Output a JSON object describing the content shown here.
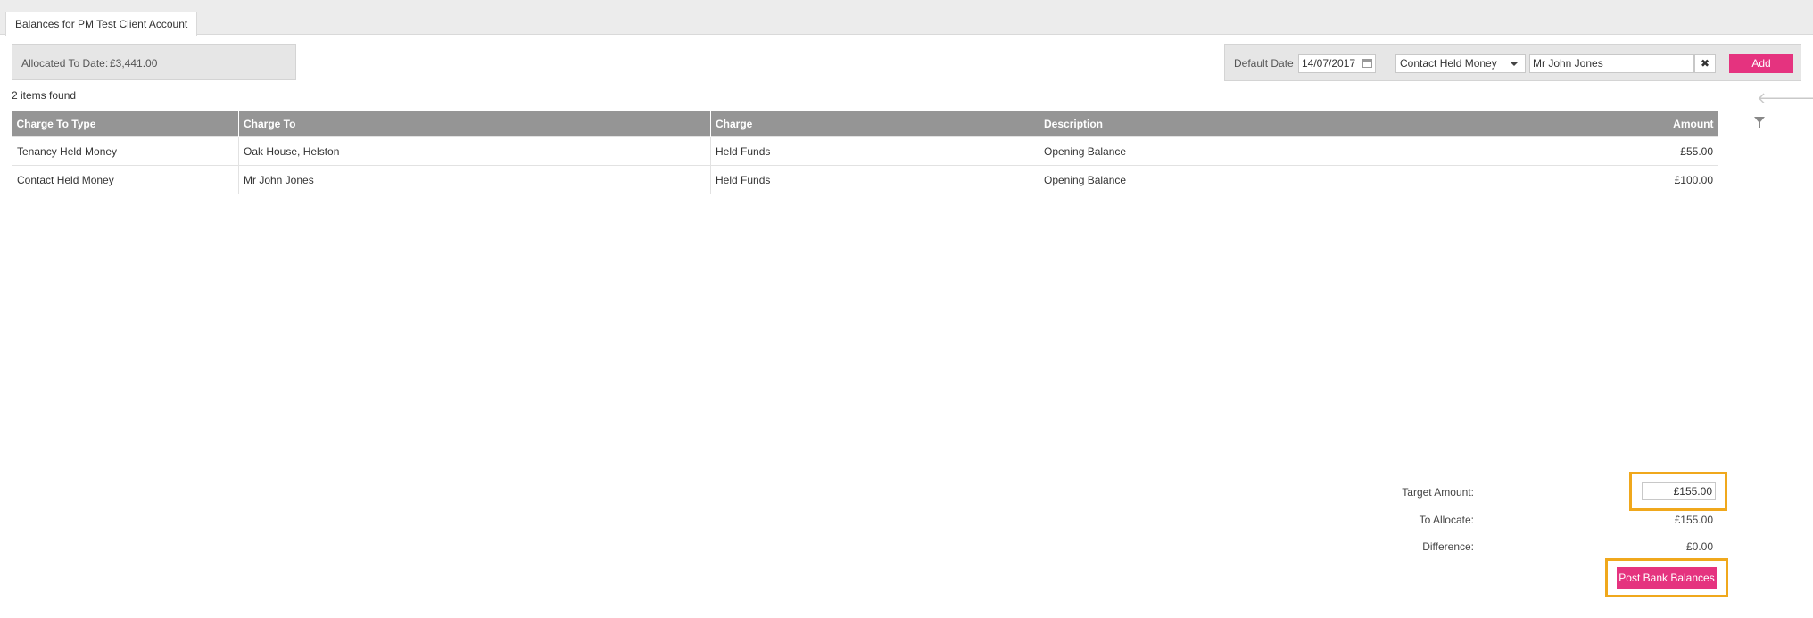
{
  "tab": {
    "label": "Balances for PM Test Client Account"
  },
  "allocated": {
    "label": "Allocated To Date:",
    "value": "£3,441.00"
  },
  "toolbar": {
    "default_date_label": "Default Date",
    "default_date_value": "14/07/2017",
    "charge_type_selected": "Contact Held Money",
    "contact_value": "Mr John Jones",
    "clear_label": "✖",
    "add_label": "Add"
  },
  "list": {
    "count_text": "2 items found"
  },
  "icons": {
    "prev": "arrow-left-icon",
    "next": "arrow-right-icon",
    "filter": "filter-icon",
    "calendar": "calendar-icon",
    "clear": "close-icon",
    "dropdown": "chevron-down-icon"
  },
  "table": {
    "headers": [
      "Charge To Type",
      "Charge To",
      "Charge",
      "Description",
      "Amount"
    ],
    "rows": [
      [
        "Tenancy Held Money",
        "Oak House, Helston",
        "Held Funds",
        "Opening Balance",
        "£55.00"
      ],
      [
        "Contact Held Money",
        "Mr John Jones",
        "Held Funds",
        "Opening Balance",
        "£100.00"
      ]
    ]
  },
  "summary": {
    "target_label": "Target Amount:",
    "target_value": "£155.00",
    "to_allocate_label": "To Allocate:",
    "to_allocate_value": "£155.00",
    "difference_label": "Difference:",
    "difference_value": "£0.00"
  },
  "post_button": {
    "label": "Post Bank Balances"
  },
  "colors": {
    "accent": "#e5337f",
    "highlight": "#f0a81c",
    "header_bg": "#959595"
  }
}
